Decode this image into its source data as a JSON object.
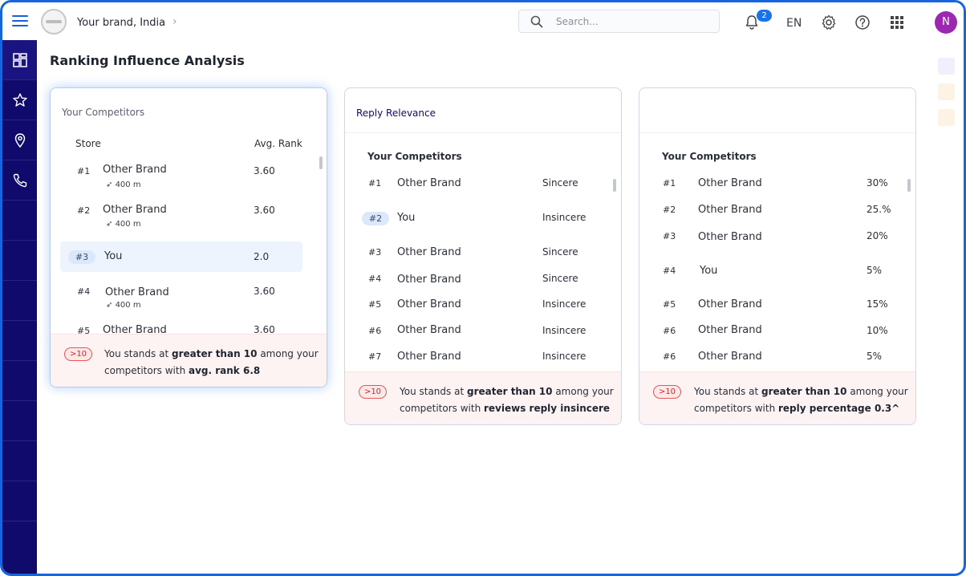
{
  "header": {
    "brand": "Your brand, India",
    "search_placeholder": "Search...",
    "notification_count": "2",
    "language": "EN",
    "avatar_initial": "N"
  },
  "sidebar": {
    "icons": [
      "dashboard-icon",
      "star-icon",
      "location-pin-icon",
      "phone-icon"
    ]
  },
  "page": {
    "title": "Ranking Influence Analysis"
  },
  "card1": {
    "title": "Your Competitors",
    "col_store": "Store",
    "col_rank": "Avg. Rank",
    "rows": [
      {
        "rank": "#1",
        "name": "Other Brand",
        "dist": "400 m",
        "value": "3.60"
      },
      {
        "rank": "#2",
        "name": "Other Brand",
        "dist": "400 m",
        "value": "3.60"
      },
      {
        "rank": "#3",
        "name": "You",
        "dist": "",
        "value": "2.0"
      },
      {
        "rank": "#4",
        "name": "Other Brand",
        "dist": "400 m",
        "value": "3.60"
      },
      {
        "rank": "#5",
        "name": "Other Brand",
        "dist": "",
        "value": "3.60"
      }
    ],
    "foot_pill": ">10",
    "foot_pre": "You stands at ",
    "foot_bold1": "greater than 10",
    "foot_mid": " among your competitors with ",
    "foot_bold2": "avg. rank 6.8"
  },
  "card2": {
    "title": "Reply Relevance",
    "subtitle": "Your Competitors",
    "rows": [
      {
        "rank": "#1",
        "name": "Other Brand",
        "value": "Sincere"
      },
      {
        "rank": "#2",
        "name": "You",
        "value": "Insincere"
      },
      {
        "rank": "#3",
        "name": "Other Brand",
        "value": "Sincere"
      },
      {
        "rank": "#4",
        "name": "Other Brand",
        "value": "Sincere"
      },
      {
        "rank": "#5",
        "name": "Other Brand",
        "value": "Insincere"
      },
      {
        "rank": "#6",
        "name": "Other Brand",
        "value": "Insincere"
      },
      {
        "rank": "#7",
        "name": "Other Brand",
        "value": "Insincere"
      }
    ],
    "foot_pill": ">10",
    "foot_pre": "You stands at ",
    "foot_bold1": "greater than 10",
    "foot_mid": " among your competitors with ",
    "foot_bold2": "reviews reply insincere"
  },
  "card3": {
    "title": "",
    "subtitle": "Your Competitors",
    "rows": [
      {
        "rank": "#1",
        "name": "Other Brand",
        "value": "30%"
      },
      {
        "rank": "#2",
        "name": "Other Brand",
        "value": "25.%"
      },
      {
        "rank": "#3",
        "name": "Other Brand",
        "value": "20%"
      },
      {
        "rank": "#4",
        "name": "You",
        "value": "5%"
      },
      {
        "rank": "#5",
        "name": "Other Brand",
        "value": "15%"
      },
      {
        "rank": "#6",
        "name": "Other Brand",
        "value": "10%"
      },
      {
        "rank": "#6",
        "name": "Other Brand",
        "value": "5%"
      }
    ],
    "foot_pill": ">10",
    "foot_pre": "You stands at ",
    "foot_bold1": "greater than 10",
    "foot_mid": " among your competitors with ",
    "foot_bold2": "reply percentage 0.3^"
  },
  "colors": {
    "sidebar": "#0f0a6b",
    "accent": "#1a73e8",
    "avatar": "#9c27b0",
    "alert": "#e05a5a"
  }
}
